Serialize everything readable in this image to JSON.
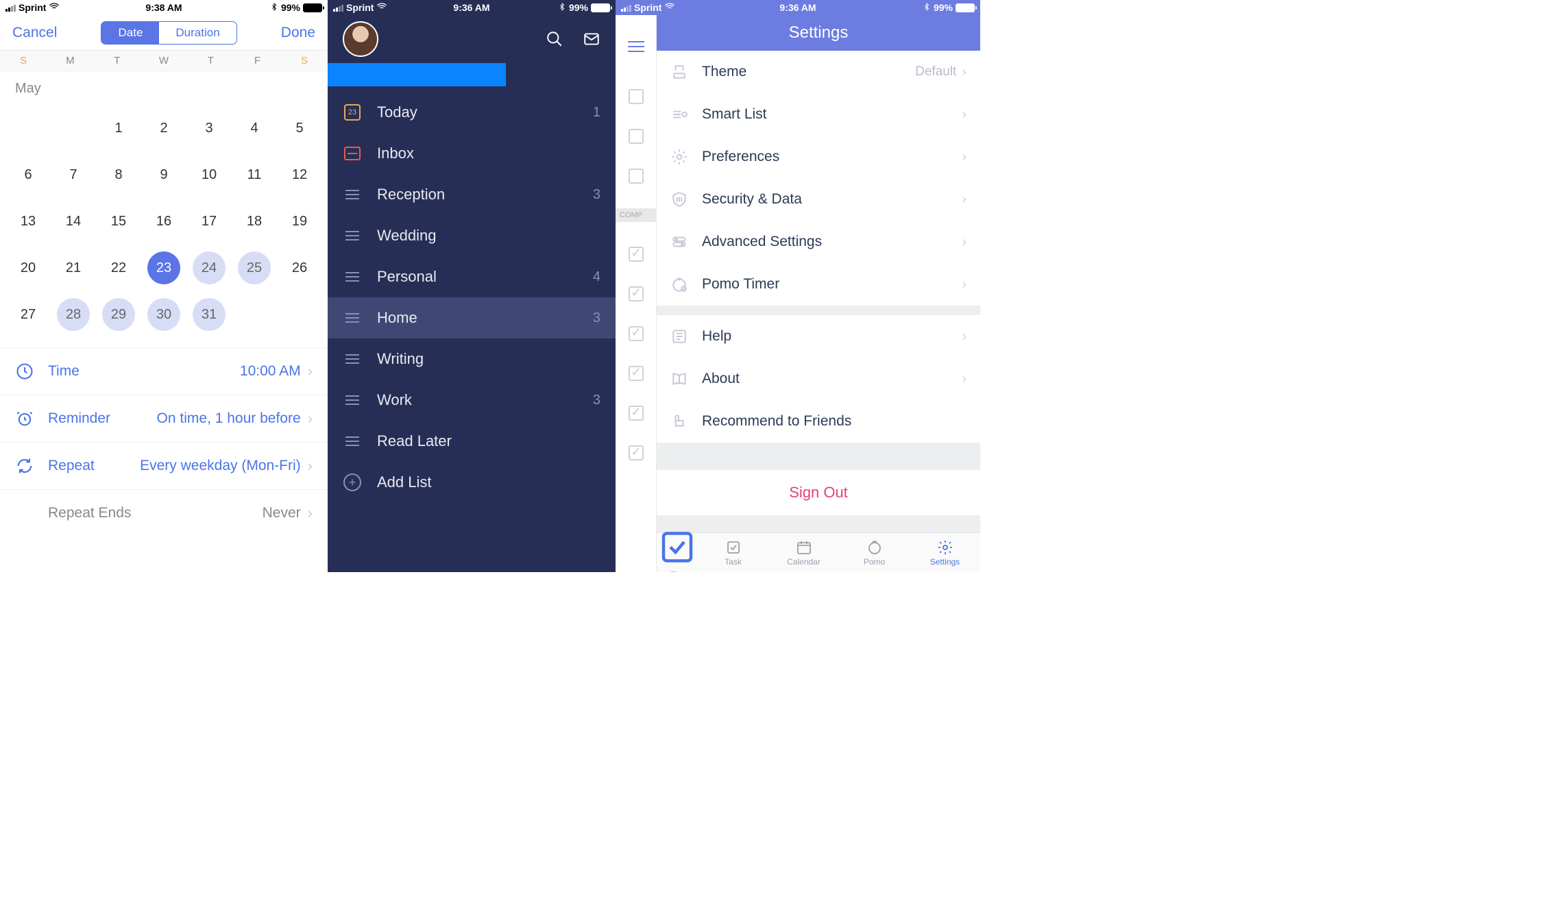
{
  "status": {
    "carrier": "Sprint",
    "time1": "9:38 AM",
    "time2": "9:36 AM",
    "time3": "9:36 AM",
    "battery": "99%",
    "bluetooth": "✱"
  },
  "screen1": {
    "cancel": "Cancel",
    "done": "Done",
    "seg_date": "Date",
    "seg_duration": "Duration",
    "days": [
      "S",
      "M",
      "T",
      "W",
      "T",
      "F",
      "S"
    ],
    "month": "May",
    "time_lbl": "Time",
    "time_val": "10:00 AM",
    "reminder_lbl": "Reminder",
    "reminder_val": "On time, 1 hour before",
    "repeat_lbl": "Repeat",
    "repeat_val": "Every weekday (Mon-Fri)",
    "repeat_ends_lbl": "Repeat Ends",
    "repeat_ends_val": "Never"
  },
  "screen2": {
    "today": "Today",
    "today_icon": "23",
    "today_cnt": "1",
    "inbox": "Inbox",
    "items": [
      {
        "label": "Reception",
        "cnt": "3"
      },
      {
        "label": "Wedding",
        "cnt": ""
      },
      {
        "label": "Personal",
        "cnt": "4"
      },
      {
        "label": "Home",
        "cnt": "3"
      },
      {
        "label": "Writing",
        "cnt": ""
      },
      {
        "label": "Work",
        "cnt": "3"
      },
      {
        "label": "Read Later",
        "cnt": ""
      }
    ],
    "add_list": "Add List"
  },
  "screen3": {
    "title": "Settings",
    "completed": "COMP",
    "group1": [
      {
        "label": "Theme",
        "val": "Default"
      },
      {
        "label": "Smart List",
        "val": ""
      },
      {
        "label": "Preferences",
        "val": ""
      },
      {
        "label": "Security & Data",
        "val": ""
      },
      {
        "label": "Advanced Settings",
        "val": ""
      },
      {
        "label": "Pomo Timer",
        "val": ""
      }
    ],
    "group2": [
      {
        "label": "Help"
      },
      {
        "label": "About"
      },
      {
        "label": "Recommend to Friends"
      }
    ],
    "signout": "Sign Out",
    "tabs": [
      {
        "label": "Tas"
      },
      {
        "label": "Task"
      },
      {
        "label": "Calendar"
      },
      {
        "label": "Pomo"
      },
      {
        "label": "Settings"
      }
    ]
  }
}
